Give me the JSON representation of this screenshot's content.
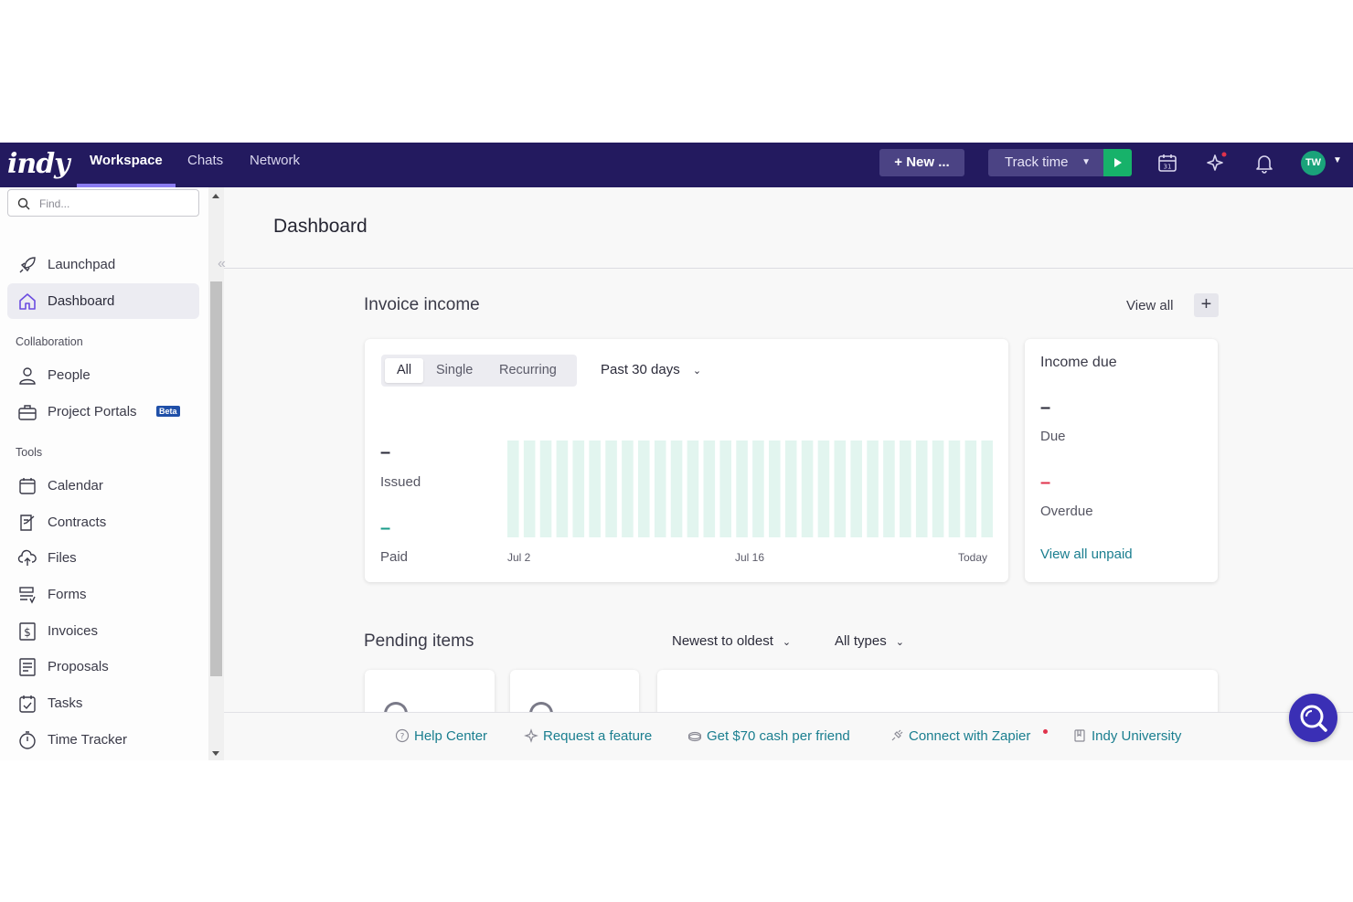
{
  "app": {
    "logo_text": "indy"
  },
  "nav": {
    "tabs": [
      {
        "label": "Workspace",
        "active": true
      },
      {
        "label": "Chats",
        "active": false
      },
      {
        "label": "Network",
        "active": false
      }
    ],
    "new_button": "+ New ...",
    "track_time": "Track time",
    "icons": [
      "calendar-icon",
      "sparkle-icon",
      "bell-icon"
    ],
    "avatar_initials": "TW",
    "accent": "#231a5f"
  },
  "sidebar": {
    "search_placeholder": "Find...",
    "items_top": [
      {
        "label": "Launchpad",
        "icon": "rocket-icon"
      },
      {
        "label": "Dashboard",
        "icon": "home-icon",
        "active": true
      }
    ],
    "collaboration_heading": "Collaboration",
    "collaboration": [
      {
        "label": "People",
        "icon": "person-icon"
      },
      {
        "label": "Project Portals",
        "icon": "briefcase-icon",
        "badge": "Beta"
      }
    ],
    "tools_heading": "Tools",
    "tools": [
      {
        "label": "Calendar",
        "icon": "calendar-icon"
      },
      {
        "label": "Contracts",
        "icon": "contract-icon"
      },
      {
        "label": "Files",
        "icon": "cloud-upload-icon"
      },
      {
        "label": "Forms",
        "icon": "form-icon"
      },
      {
        "label": "Invoices",
        "icon": "dollar-icon"
      },
      {
        "label": "Proposals",
        "icon": "proposal-icon"
      },
      {
        "label": "Tasks",
        "icon": "checklist-icon"
      },
      {
        "label": "Time Tracker",
        "icon": "stopwatch-icon"
      }
    ]
  },
  "main": {
    "title": "Dashboard",
    "invoice_income": {
      "title": "Invoice income",
      "view_all": "View all",
      "segments": [
        "All",
        "Single",
        "Recurring"
      ],
      "active_segment": "All",
      "range": "Past 30 days",
      "issued_value": "–",
      "issued_label": "Issued",
      "paid_value": "–",
      "paid_label": "Paid",
      "x_ticks": [
        "Jul 2",
        "Jul 16",
        "Today"
      ],
      "bar_count": 30,
      "bar_color": "#e2f5ef"
    },
    "income_due": {
      "title": "Income due",
      "due_value": "–",
      "due_label": "Due",
      "overdue_value": "–",
      "overdue_label": "Overdue",
      "link": "View all unpaid"
    },
    "pending": {
      "title": "Pending items",
      "sort": "Newest to oldest",
      "filter": "All types"
    }
  },
  "footer": {
    "links": [
      {
        "label": "Help Center",
        "icon": "question-icon"
      },
      {
        "label": "Request a feature",
        "icon": "sparkle-icon"
      },
      {
        "label": "Get $70 cash per friend",
        "icon": "cash-icon"
      },
      {
        "label": "Connect with Zapier",
        "icon": "plug-icon"
      },
      {
        "label": "Indy University",
        "icon": "book-icon"
      }
    ]
  }
}
